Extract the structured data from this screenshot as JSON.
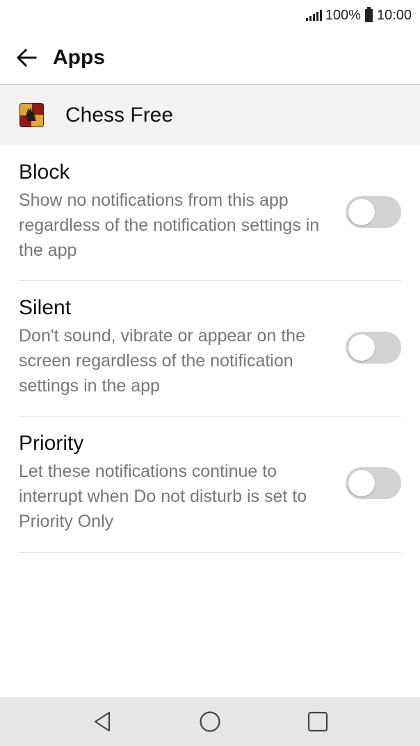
{
  "status_bar": {
    "battery_percent": "100%",
    "time": "10:00",
    "icons": [
      "signal-icon",
      "battery-icon"
    ]
  },
  "header": {
    "title": "Apps",
    "back_icon": "back-arrow-icon"
  },
  "app": {
    "name": "Chess Free",
    "icon": "chess-app-icon"
  },
  "settings": [
    {
      "title": "Block",
      "description": "Show no notifications from this app regardless of the notification settings in the app",
      "enabled": false
    },
    {
      "title": "Silent",
      "description": "Don't sound, vibrate or appear on the screen regardless of the notification settings in the app",
      "enabled": false
    },
    {
      "title": "Priority",
      "description": "Let these notifications continue to interrupt when Do not disturb is set to Priority Only",
      "enabled": false
    }
  ],
  "nav_bar": {
    "buttons": [
      "back-triangle-icon",
      "home-circle-icon",
      "recents-square-icon"
    ]
  },
  "colors": {
    "toggle_off_track": "#d2d2d2",
    "app_row_background": "#f3f3f3",
    "nav_bar_background": "#e6e6e6",
    "description_text": "#777777"
  }
}
